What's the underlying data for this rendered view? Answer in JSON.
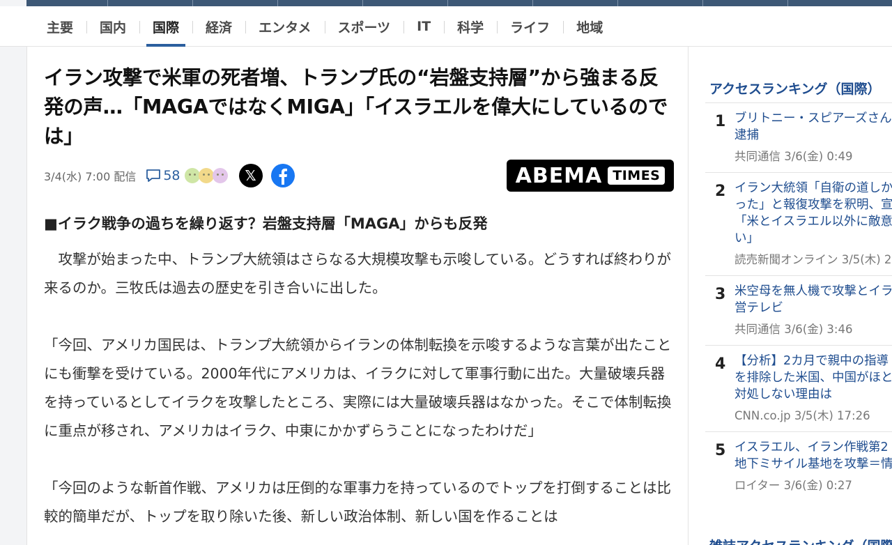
{
  "nav": {
    "items": [
      "主要",
      "国内",
      "国際",
      "経済",
      "エンタメ",
      "スポーツ",
      "IT",
      "科学",
      "ライフ",
      "地域"
    ],
    "active_index": 2
  },
  "article": {
    "headline": "イラン攻撃で米軍の死者増、トランプ氏の“岩盤支持層”から強まる反発の声…「MAGAではなくMIGA」「イスラエルを偉大にしているのでは」",
    "date": "3/4(水) 7:00 配信",
    "comment_count": "58",
    "x_glyph": "𝕏",
    "logo_main": "ABEMA",
    "logo_sub": "TIMES",
    "subhead": "■イラク戦争の過ちを繰り返す？岩盤支持層「MAGA」からも反発",
    "paragraphs": [
      "攻撃が始まった中、トランプ大統領はさらなる大規模攻撃も示唆している。どうすれば終わりが来るのか。三牧氏は過去の歴史を引き合いに出した。",
      "「今回、アメリカ国民は、トランプ大統領からイランの体制転換を示唆するような言葉が出たことにも衝撃を受けている。2000年代にアメリカは、イラクに対して軍事行動に出た。大量破壊兵器を持っているとしてイラクを攻撃したところ、実際には大量破壊兵器はなかった。そこで体制転換に重点が移され、アメリカはイラク、中東にかかずらうことになったわけだ」",
      "「今回のような斬首作戦、アメリカは圧倒的な軍事力を持っているのでトップを打倒することは比較的簡単だが、トップを取り除いた後、新しい政治体制、新しい国を作ることは"
    ],
    "reaction_colors": [
      "#cfe6a6",
      "#f2d98a",
      "#e3c6ea"
    ]
  },
  "sidebar": {
    "ranking_title": "アクセスランキング（国際）",
    "items": [
      {
        "rank": "1",
        "title": "ブリトニー・スピアーズさん\n逮捕",
        "source": "共同通信 3/6(金) 0:49"
      },
      {
        "rank": "2",
        "title": "イラン大統領「自衛の道しか\nった」と報復攻撃を釈明、宣\n「米とイスラエル以外に敵意\nい」",
        "source": "読売新聞オンライン 3/5(木) 2"
      },
      {
        "rank": "3",
        "title": "米空母を無人機で攻撃とイラ\n営テレビ",
        "source": "共同通信 3/6(金) 3:46"
      },
      {
        "rank": "4",
        "title": "【分析】2カ月で親中の指導\nを排除した米国、中国がほと\n対処しない理由は",
        "source": "CNN.co.jp 3/5(木) 17:26"
      },
      {
        "rank": "5",
        "title": "イスラエル、イラン作戦第2\n地下ミサイル基地を攻撃＝情",
        "source": "ロイター 3/6(金) 0:27"
      }
    ],
    "next_title": "雑誌アクセスランキング（国際"
  }
}
